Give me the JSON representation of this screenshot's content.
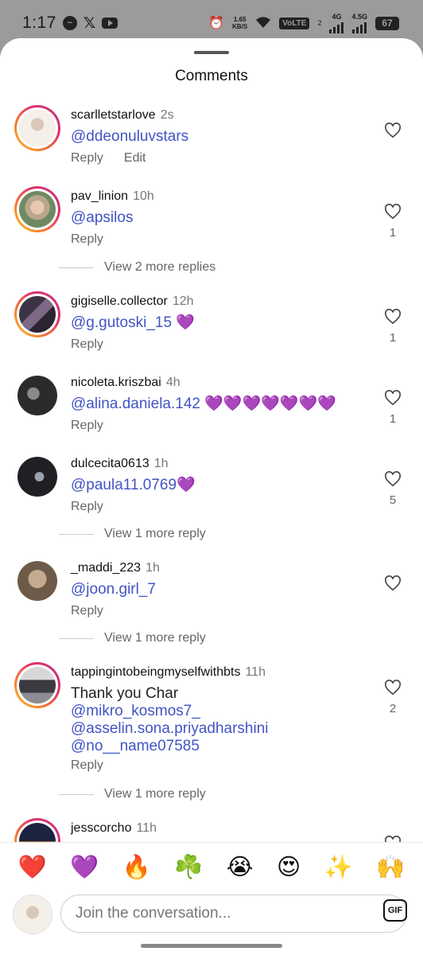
{
  "status_bar": {
    "time": "1:17",
    "speed_value": "1.65",
    "speed_unit": "KB/S",
    "volte": "VoLTE",
    "sim": "2",
    "net1": "4G",
    "net2": "4.5G",
    "battery": "67"
  },
  "sheet": {
    "title": "Comments"
  },
  "comments": [
    {
      "username": "scarlletstarlove",
      "time": "2s",
      "lines": [],
      "mentions": [
        "ddeonuluvstars"
      ],
      "reply": "Reply",
      "edit": "Edit",
      "likes": ""
    },
    {
      "username": "pav_linion",
      "time": "10h",
      "lines": [],
      "mentions": [
        "apsilos"
      ],
      "reply": "Reply",
      "likes": "1"
    },
    {
      "username": "gigiselle.collector",
      "time": "12h",
      "lines": [],
      "mentions": [
        "g.gutoski_15"
      ],
      "suffix": " 💜",
      "reply": "Reply",
      "likes": "1"
    },
    {
      "username": "nicoleta.kriszbai",
      "time": "4h",
      "lines": [],
      "mentions": [
        "alina.daniela.142"
      ],
      "suffix": " 💜💜💜💜💜💜💜",
      "reply": "Reply",
      "likes": "1"
    },
    {
      "username": "dulcecita0613",
      "time": "1h",
      "lines": [],
      "mentions": [
        "paula11.0769"
      ],
      "suffix": "💜",
      "reply": "Reply",
      "likes": "5"
    },
    {
      "username": "_maddi_223",
      "time": "1h",
      "lines": [],
      "mentions": [
        "joon.girl_7"
      ],
      "reply": "Reply",
      "likes": ""
    },
    {
      "username": "tappingintobeingmyselfwithbts",
      "time": "11h",
      "text": "Thank you Char",
      "mentions": [
        "mikro_kosmos7_",
        "asselin.sona.priyadharshini",
        "no__name07585"
      ],
      "reply": "Reply",
      "likes": "2"
    },
    {
      "username": "jesscorcho",
      "time": "11h",
      "mentions": [],
      "reply": "",
      "likes": ""
    }
  ],
  "view_more": [
    "View 2 more replies",
    "View 1 more reply",
    "View 1 more reply",
    "View 1 more reply"
  ],
  "emoji_bar": [
    "❤️",
    "💜",
    "🔥",
    "☘️",
    "😭",
    "😍",
    "✨",
    "🙌"
  ],
  "composer": {
    "placeholder": "Join the conversation...",
    "gif_label": "GIF"
  },
  "colors": {
    "mention": "#4154c4",
    "ring_start": "#fdc52a",
    "ring_end": "#c13584"
  }
}
